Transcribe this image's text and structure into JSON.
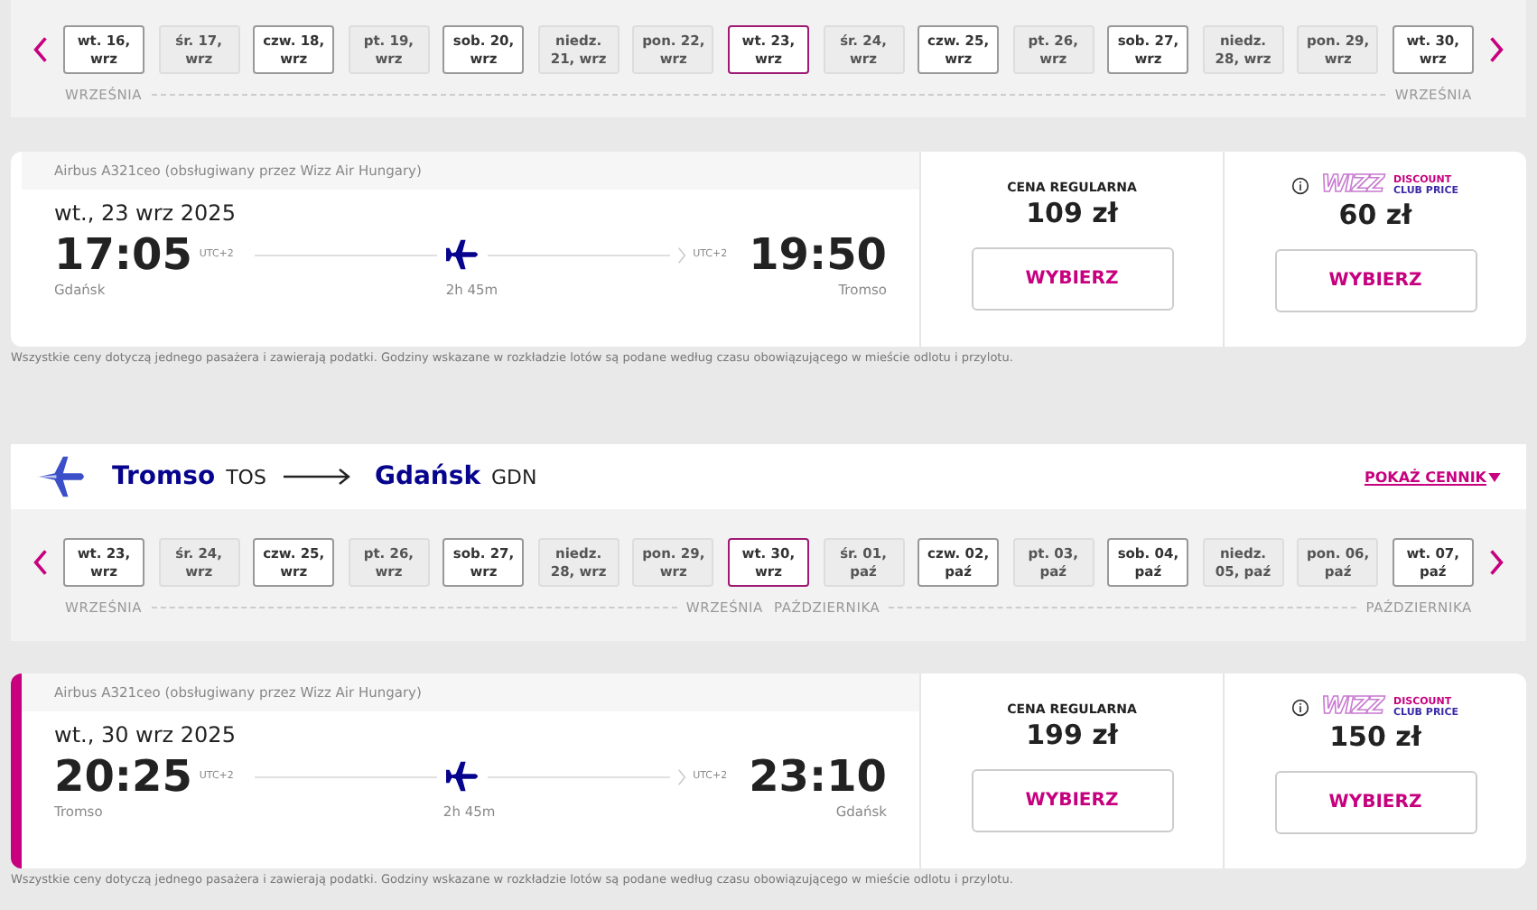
{
  "segments": [
    {
      "dates": [
        {
          "day": "wt. 16,",
          "month": "wrz",
          "available": true,
          "selected": false
        },
        {
          "day": "śr. 17,",
          "month": "wrz",
          "available": false,
          "selected": false
        },
        {
          "day": "czw. 18,",
          "month": "wrz",
          "available": true,
          "selected": false
        },
        {
          "day": "pt. 19,",
          "month": "wrz",
          "available": false,
          "selected": false
        },
        {
          "day": "sob. 20,",
          "month": "wrz",
          "available": true,
          "selected": false
        },
        {
          "day": "niedz.",
          "month": "21, wrz",
          "available": false,
          "selected": false
        },
        {
          "day": "pon. 22,",
          "month": "wrz",
          "available": false,
          "selected": false
        },
        {
          "day": "wt. 23,",
          "month": "wrz",
          "available": true,
          "selected": true
        },
        {
          "day": "śr. 24,",
          "month": "wrz",
          "available": false,
          "selected": false
        },
        {
          "day": "czw. 25,",
          "month": "wrz",
          "available": true,
          "selected": false
        },
        {
          "day": "pt. 26,",
          "month": "wrz",
          "available": false,
          "selected": false
        },
        {
          "day": "sob. 27,",
          "month": "wrz",
          "available": true,
          "selected": false
        },
        {
          "day": "niedz.",
          "month": "28, wrz",
          "available": false,
          "selected": false
        },
        {
          "day": "pon. 29,",
          "month": "wrz",
          "available": false,
          "selected": false
        },
        {
          "day": "wt. 30,",
          "month": "wrz",
          "available": true,
          "selected": false
        }
      ],
      "months": [
        {
          "start": "WRZEŚNIA",
          "end": "WRZEŚNIA"
        }
      ],
      "card": {
        "selected": false,
        "aircraft": "Airbus A321ceo (obsługiwany przez Wizz Air Hungary)",
        "date": "wt., 23 wrz 2025",
        "dep_time": "17:05",
        "dep_tz": "UTC+2",
        "arr_time": "19:50",
        "arr_tz": "UTC+2",
        "from": "Gdańsk",
        "to": "Tromso",
        "duration": "2h 45m",
        "regular_label": "CENA REGULARNA",
        "regular_price": "109 zł",
        "discount_logo": "WIZZ",
        "discount_top": "DISCOUNT",
        "discount_bottom": "CLUB PRICE",
        "discount_price": "60 zł",
        "regular_button": "WYBIERZ",
        "discount_button": "WYBIERZ"
      },
      "note": "Wszystkie ceny dotyczą jednego pasażera i zawierają podatki. Godziny wskazane w rozkładzie lotów są podane według czasu obowiązującego w mieście odlotu i przylotu."
    },
    {
      "route": {
        "from": "Tromso",
        "from_code": "TOS",
        "to": "Gdańsk",
        "to_code": "GDN",
        "link": "POKAŻ CENNIK"
      },
      "dates": [
        {
          "day": "wt. 23,",
          "month": "wrz",
          "available": true,
          "selected": false
        },
        {
          "day": "śr. 24,",
          "month": "wrz",
          "available": false,
          "selected": false
        },
        {
          "day": "czw. 25,",
          "month": "wrz",
          "available": true,
          "selected": false
        },
        {
          "day": "pt. 26,",
          "month": "wrz",
          "available": false,
          "selected": false
        },
        {
          "day": "sob. 27,",
          "month": "wrz",
          "available": true,
          "selected": false
        },
        {
          "day": "niedz.",
          "month": "28, wrz",
          "available": false,
          "selected": false
        },
        {
          "day": "pon. 29,",
          "month": "wrz",
          "available": false,
          "selected": false
        },
        {
          "day": "wt. 30,",
          "month": "wrz",
          "available": true,
          "selected": true
        },
        {
          "day": "śr. 01,",
          "month": "paź",
          "available": false,
          "selected": false
        },
        {
          "day": "czw. 02,",
          "month": "paź",
          "available": true,
          "selected": false
        },
        {
          "day": "pt. 03,",
          "month": "paź",
          "available": false,
          "selected": false
        },
        {
          "day": "sob. 04,",
          "month": "paź",
          "available": true,
          "selected": false
        },
        {
          "day": "niedz.",
          "month": "05, paź",
          "available": false,
          "selected": false
        },
        {
          "day": "pon. 06,",
          "month": "paź",
          "available": false,
          "selected": false
        },
        {
          "day": "wt. 07,",
          "month": "paź",
          "available": true,
          "selected": false
        }
      ],
      "months": [
        {
          "start": "WRZEŚNIA",
          "end": "WRZEŚNIA"
        },
        {
          "start": "PAŹDZIERNIKA",
          "end": "PAŹDZIERNIKA"
        }
      ],
      "card": {
        "selected": true,
        "aircraft": "Airbus A321ceo (obsługiwany przez Wizz Air Hungary)",
        "date": "wt., 30 wrz 2025",
        "dep_time": "20:25",
        "dep_tz": "UTC+2",
        "arr_time": "23:10",
        "arr_tz": "UTC+2",
        "from": "Tromso",
        "to": "Gdańsk",
        "duration": "2h 45m",
        "regular_label": "CENA REGULARNA",
        "regular_price": "199 zł",
        "discount_logo": "WIZZ",
        "discount_top": "DISCOUNT",
        "discount_bottom": "CLUB PRICE",
        "discount_price": "150 zł",
        "regular_button": "WYBIERZ",
        "discount_button": "WYBIERZ"
      },
      "note": "Wszystkie ceny dotyczą jednego pasażera i zawierają podatki. Godziny wskazane w rozkładzie lotów są podane według czasu obowiązującego w mieście odlotu i przylotu."
    }
  ]
}
